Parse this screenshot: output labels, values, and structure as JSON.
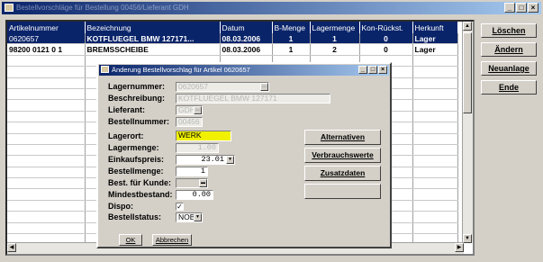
{
  "window": {
    "title": "Bestellvorschläge für Bestellung 00456/Lieferant GDH"
  },
  "grid": {
    "columns": [
      "Artikelnummer",
      "Bezeichnung",
      "Datum",
      "B-Menge",
      "Lagermenge",
      "Kon-Rückst.",
      "Herkunft"
    ],
    "rows": [
      [
        "0620657",
        "KOTFLUEGEL  BMW  127171...",
        "08.03.2006",
        "1",
        "1",
        "0",
        "Lager"
      ],
      [
        "98200 0121 0 1",
        "BREMSSCHEIBE",
        "08.03.2006",
        "1",
        "2",
        "0",
        "Lager"
      ]
    ]
  },
  "side_buttons": [
    "Löschen",
    "Ändern",
    "Neuanlage",
    "Ende"
  ],
  "dialog": {
    "title": "Änderung Bestellvorschlag für Artikel 0620657",
    "labels": {
      "lagernummer": "Lagernummer:",
      "beschreibung": "Beschreibung:",
      "lieferant": "Lieferant:",
      "bestellnummer": "Bestellnummer:",
      "lagerort": "Lagerort:",
      "lagermenge": "Lagermenge:",
      "einkaufspreis": "Einkaufspreis:",
      "bestellmenge": "Bestellmenge:",
      "best_fuer_kunde": "Best. für Kunde:",
      "mindestbestand": "Mindestbestand:",
      "dispo": "Dispo:",
      "bestellstatus": "Bestellstatus:"
    },
    "values": {
      "lagernummer": "0620657",
      "beschreibung": "KOTFLUEGEL  BMW  127171",
      "lieferant": "GDH",
      "bestellnummer": "00456",
      "lagerort": "WERK",
      "lagermenge": "1.00",
      "einkaufspreis": "23.01",
      "bestellmenge": "1",
      "best_fuer_kunde": "",
      "mindestbestand": "0.00",
      "dispo_checked": true,
      "bestellstatus": "NOB"
    },
    "buttons": [
      "Alternativen",
      "Verbrauchswerte",
      "Zusatzdaten"
    ],
    "ok_label": "OK",
    "cancel_label": "Abbrechen"
  },
  "colors": {
    "selection": "#0a246a",
    "highlight_field": "#f0f000",
    "window_bg": "#d4d0c8"
  }
}
